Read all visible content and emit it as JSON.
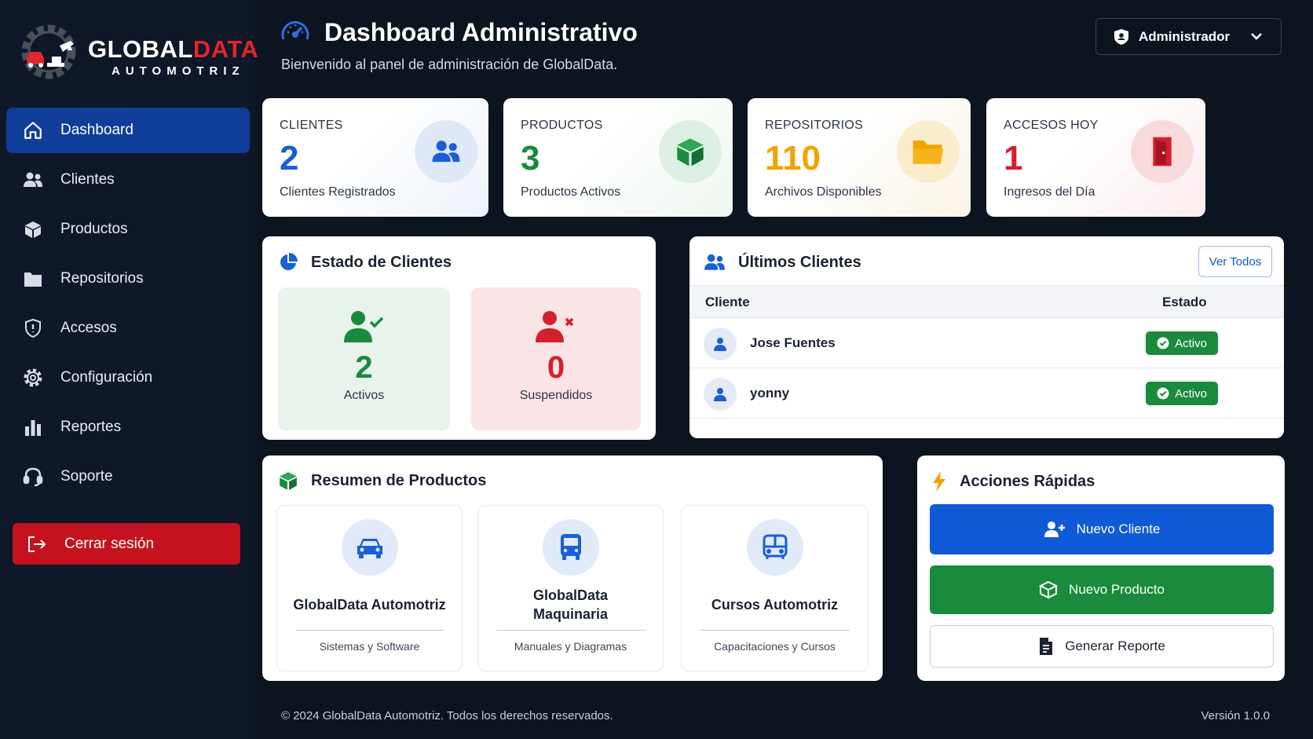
{
  "brand": {
    "name_part1": "GLOBAL",
    "name_part2": "DATA",
    "subtitle": "AUTOMOTRIZ"
  },
  "sidebar": {
    "items": [
      {
        "label": "Dashboard",
        "icon": "home-icon",
        "active": true
      },
      {
        "label": "Clientes",
        "icon": "users-icon"
      },
      {
        "label": "Productos",
        "icon": "box-icon"
      },
      {
        "label": "Repositorios",
        "icon": "folder-icon"
      },
      {
        "label": "Accesos",
        "icon": "shield-icon"
      },
      {
        "label": "Configuración",
        "icon": "gear-icon"
      },
      {
        "label": "Reportes",
        "icon": "bar-chart-icon"
      },
      {
        "label": "Soporte",
        "icon": "headset-icon"
      }
    ],
    "logout_label": "Cerrar sesión"
  },
  "header": {
    "title": "Dashboard Administrativo",
    "subtitle": "Bienvenido al panel de administración de GlobalData.",
    "user_role": "Administrador"
  },
  "stats": [
    {
      "label": "CLIENTES",
      "value": "2",
      "desc": "Clientes Registrados",
      "color": "#1a5fd6"
    },
    {
      "label": "PRODUCTOS",
      "value": "3",
      "desc": "Productos Activos",
      "color": "#1a8a3d"
    },
    {
      "label": "REPOSITORIOS",
      "value": "110",
      "desc": "Archivos Disponibles",
      "color": "#f0a400"
    },
    {
      "label": "ACCESOS HOY",
      "value": "1",
      "desc": "Ingresos del Día",
      "color": "#d41f2f"
    }
  ],
  "estado": {
    "title": "Estado de Clientes",
    "activos": {
      "value": "2",
      "label": "Activos"
    },
    "suspendidos": {
      "value": "0",
      "label": "Suspendidos"
    }
  },
  "ultimos": {
    "title": "Últimos Clientes",
    "ver_todos": "Ver Todos",
    "col_cliente": "Cliente",
    "col_estado": "Estado",
    "rows": [
      {
        "name": "Jose Fuentes",
        "status": "Activo"
      },
      {
        "name": "yonny",
        "status": "Activo"
      }
    ]
  },
  "productos": {
    "title": "Resumen de Productos",
    "items": [
      {
        "name": "GlobalData Automotriz",
        "sub": "Sistemas y Software",
        "icon": "car-icon"
      },
      {
        "name": "GlobalData Maquinaria",
        "sub": "Manuales y Diagramas",
        "icon": "bus-icon"
      },
      {
        "name": "Cursos Automotriz",
        "sub": "Capacitaciones y Cursos",
        "icon": "bus-icon"
      }
    ]
  },
  "acciones": {
    "title": "Acciones Rápidas",
    "nuevo_cliente": "Nuevo Cliente",
    "nuevo_producto": "Nuevo Producto",
    "generar_reporte": "Generar Reporte"
  },
  "footer": {
    "copyright": "© 2024 GlobalData Automotriz. Todos los derechos reservados.",
    "version": "Versión 1.0.0"
  }
}
